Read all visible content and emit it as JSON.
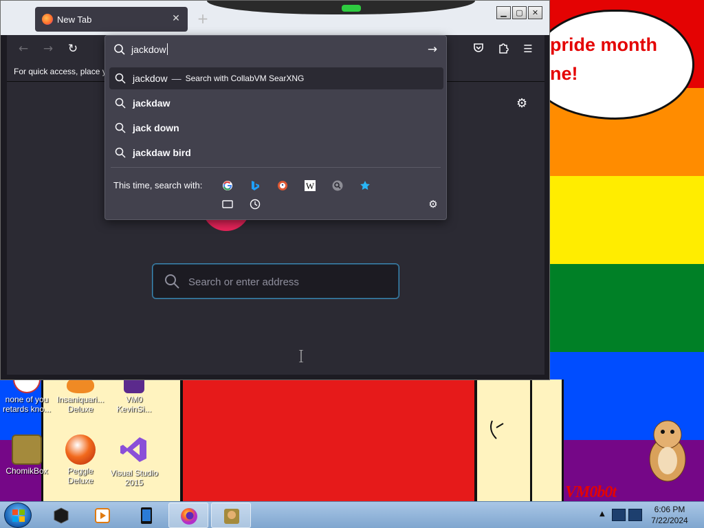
{
  "wallpaper": {
    "stripe_colors": [
      "#e40303",
      "#ff8c00",
      "#ffed00",
      "#008026",
      "#004dff",
      "#750787"
    ],
    "speech_text": "pride month\nne!",
    "watermark": "VM0b0t"
  },
  "desktop_icons": [
    {
      "label": "none of you retards kno...",
      "icon": "app-icon"
    },
    {
      "label": "Insaniquari... Deluxe",
      "icon": "fish-icon"
    },
    {
      "label": "VM0 KevinSi...",
      "icon": "app-icon"
    },
    {
      "label": "ChomikBox",
      "icon": "hamster-box-icon"
    },
    {
      "label": "Peggle Deluxe",
      "icon": "peggle-icon"
    },
    {
      "label": "Visual Studio 2015",
      "icon": "visual-studio-icon"
    }
  ],
  "browser": {
    "tab": {
      "label": "New Tab",
      "close": "✕"
    },
    "new_tab": "+",
    "window_buttons": {
      "minimize": "▁",
      "maximize": "▢",
      "close": "✕"
    },
    "bookmarks_hint": "For quick access, place yo",
    "page_search_placeholder": "Search or enter address",
    "urlbar": {
      "typed": "jackdow",
      "suggestions": [
        {
          "text": "jackdow",
          "action": "Search with CollabVM SearXNG",
          "selected": true
        },
        {
          "text": "jackdaw",
          "action": "",
          "selected": false
        },
        {
          "text": "jack down",
          "action": "",
          "selected": false
        },
        {
          "text": "jackdaw bird",
          "action": "",
          "selected": false
        }
      ],
      "separator": "—",
      "search_with_label": "This time, search with:",
      "engines": [
        "google",
        "bing",
        "duckduckgo",
        "wikipedia",
        "searxng",
        "bookmarks"
      ],
      "row2": [
        "tabs",
        "history"
      ]
    }
  },
  "taskbar": {
    "items": [
      "terminal",
      "media-player",
      "tablet-app",
      "firefox",
      "chomikbox"
    ],
    "active_items": [
      "firefox",
      "chomikbox"
    ],
    "clock_time": "6:06 PM",
    "clock_date": "7/22/2024"
  }
}
